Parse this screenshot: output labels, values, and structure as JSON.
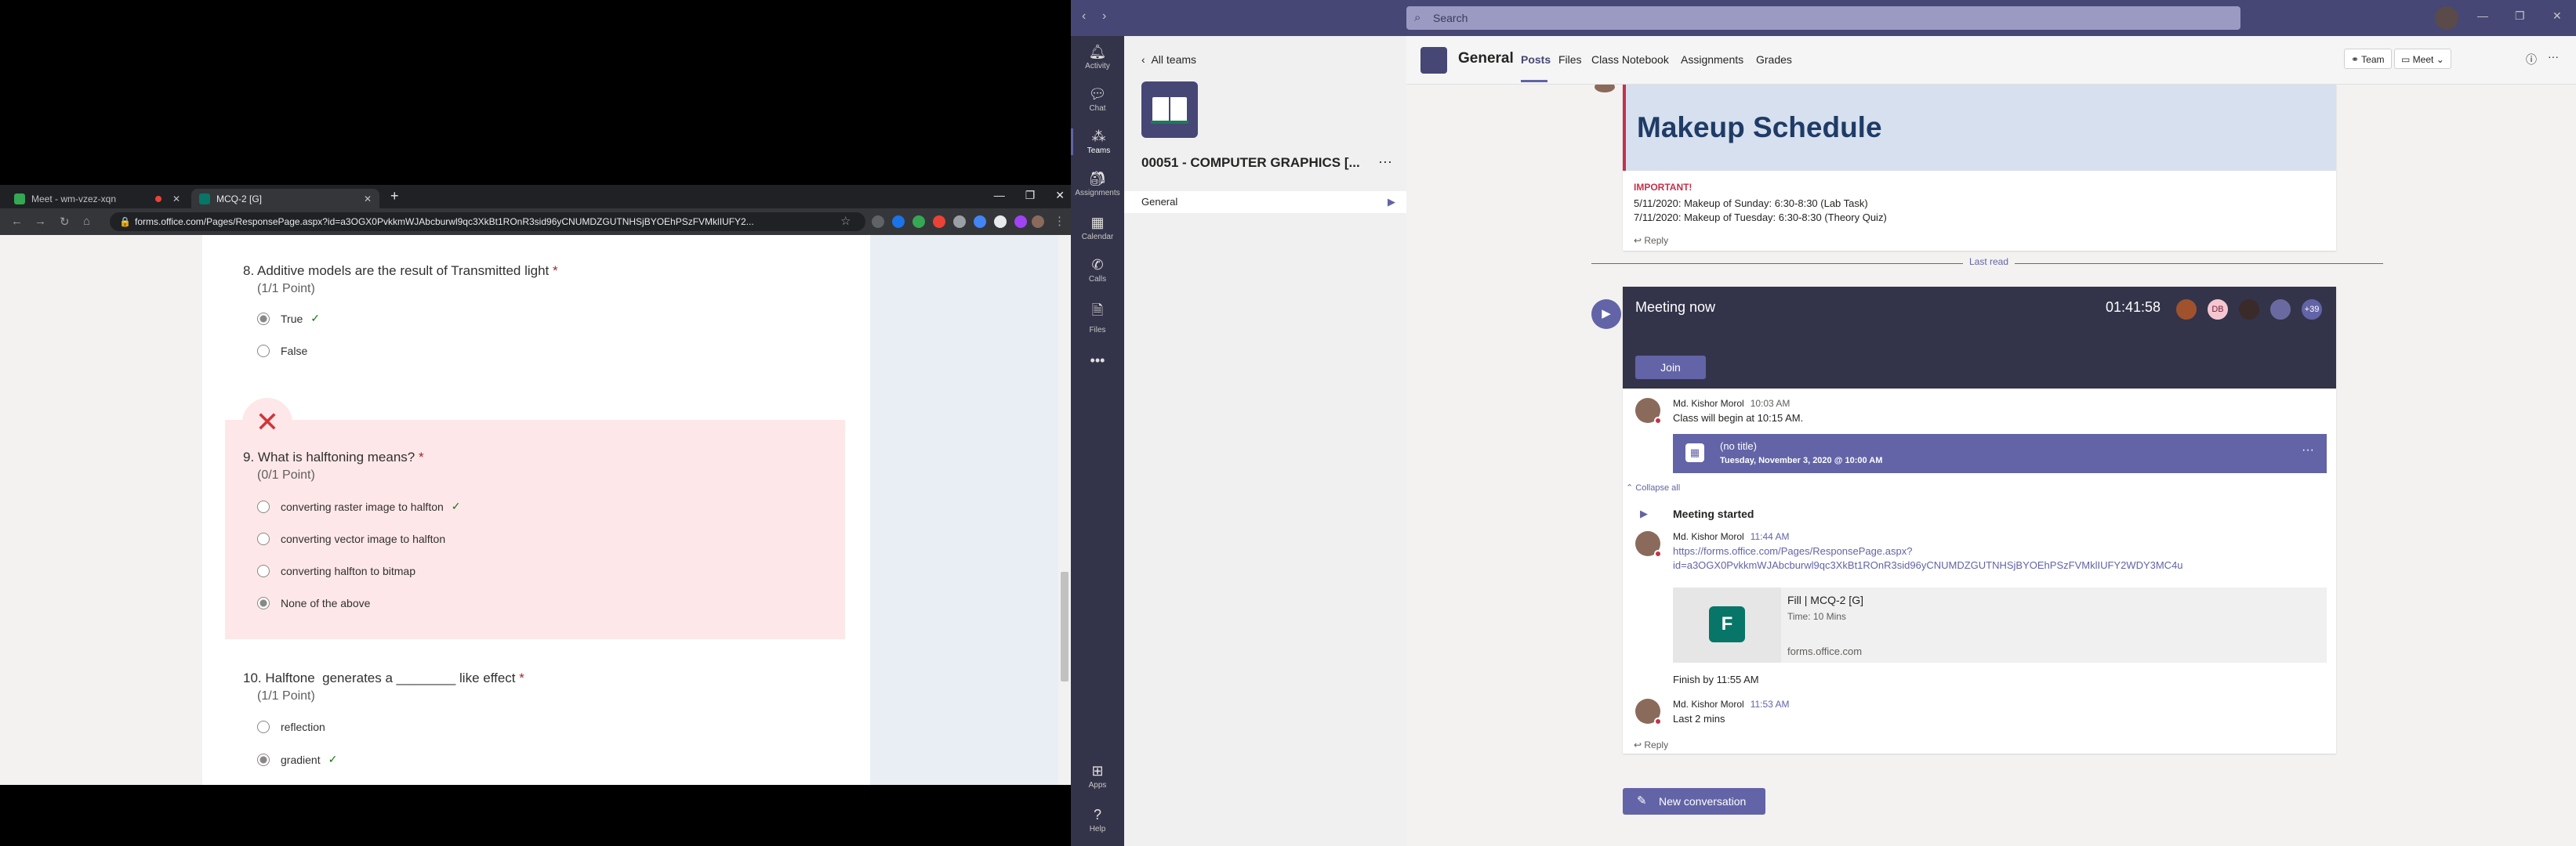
{
  "browser": {
    "tabs": [
      {
        "title": "Meet - wm-vzez-xqn",
        "favicon_color": "#34a853",
        "recording": true
      },
      {
        "title": "MCQ-2 [G]",
        "favicon_color": "#077568",
        "recording": false
      }
    ],
    "new_tab_label": "+",
    "url": "forms.office.com/Pages/ResponsePage.aspx?id=a3OGX0PvkkmWJAbcburwl9qc3XkBt1ROnR3sid96yCNUMDZGUTNHSjBYOEhPSzFVMklIUFY2..."
  },
  "form": {
    "questions": [
      {
        "number": "8.",
        "text": "Additive models are the result of Transmitted light",
        "required": "*",
        "points": "(1/1 Point)",
        "options": [
          {
            "label": "True",
            "selected": true,
            "correct": true
          },
          {
            "label": "False",
            "selected": false,
            "correct": false
          }
        ]
      },
      {
        "number": "9.",
        "text": "What is halftoning means?",
        "required": "*",
        "points": "(0/1 Point)",
        "wrong": true,
        "options": [
          {
            "label": "converting raster image to halfton",
            "selected": false,
            "correct": true
          },
          {
            "label": "converting vector image to halfton",
            "selected": false,
            "correct": false
          },
          {
            "label": "converting halfton to bitmap",
            "selected": false,
            "correct": false
          },
          {
            "label": "None of the above",
            "selected": true,
            "correct": false
          }
        ]
      },
      {
        "number": "10.",
        "text": "Halftone  generates a ________ like effect",
        "required": "*",
        "points": "(1/1 Point)",
        "options": [
          {
            "label": "reflection",
            "selected": false,
            "correct": false
          },
          {
            "label": "gradient",
            "selected": true,
            "correct": true
          }
        ]
      }
    ]
  },
  "teams": {
    "search_placeholder": "Search",
    "rail": [
      {
        "label": "Activity",
        "icon": "bell-icon"
      },
      {
        "label": "Chat",
        "icon": "chat-icon"
      },
      {
        "label": "Teams",
        "icon": "teams-icon"
      },
      {
        "label": "Assignments",
        "icon": "assignments-icon"
      },
      {
        "label": "Calendar",
        "icon": "calendar-icon"
      },
      {
        "label": "Calls",
        "icon": "phone-icon"
      },
      {
        "label": "Files",
        "icon": "files-icon"
      },
      {
        "label": "Apps",
        "icon": "apps-icon"
      },
      {
        "label": "Help",
        "icon": "help-icon"
      }
    ],
    "all_teams": "All teams",
    "team_name": "00051 - COMPUTER GRAPHICS [...",
    "channel": "General",
    "channel_title": "General",
    "tabs": [
      "Posts",
      "Files",
      "Class Notebook",
      "Assignments",
      "Grades"
    ],
    "header_buttons": {
      "team": "Team",
      "meet": "Meet"
    },
    "posts": {
      "schedule": {
        "title": "Makeup Schedule",
        "important": "IMPORTANT!",
        "lines": [
          "5/11/2020: Makeup of Sunday: 6:30-8:30 (Lab Task)",
          "7/11/2020: Makeup of Tuesday: 6:30-8:30 (Theory Quiz)"
        ],
        "reply": "Reply"
      },
      "last_read": "Last read",
      "meeting": {
        "title": "Meeting now",
        "timer": "01:41:58",
        "avatar_initials": [
          "",
          "DB",
          "",
          ""
        ],
        "more_count": "+39",
        "join": "Join",
        "messages": [
          {
            "author": "Md. Kishor Morol",
            "time": "10:03 AM",
            "text": "Class will begin at 10:15 AM."
          }
        ],
        "event": {
          "title": "(no title)",
          "subtitle": "Tuesday, November 3, 2020 @ 10:00 AM"
        },
        "collapse_all": "Collapse all",
        "meeting_started": "Meeting started",
        "message2": {
          "author": "Md. Kishor Morol",
          "time": "11:44 AM",
          "link_line1": "https://forms.office.com/Pages/ResponsePage.aspx?",
          "link_line2": "id=a3OGX0PvkkmWJAbcburwl9qc3XkBt1ROnR3sid96yCNUMDZGUTNHSjBYOEhPSzFVMklIUFY2WDY3MC4u",
          "preview_title": "Fill | MCQ-2 [G]",
          "preview_sub": "Time: 10 Mins",
          "preview_domain": "forms.office.com",
          "text": "Finish by 11:55 AM"
        },
        "message3": {
          "author": "Md. Kishor Morol",
          "time": "11:53 AM",
          "text": "Last 2 mins"
        },
        "reply": "Reply"
      },
      "new_conversation": "New conversation"
    }
  }
}
